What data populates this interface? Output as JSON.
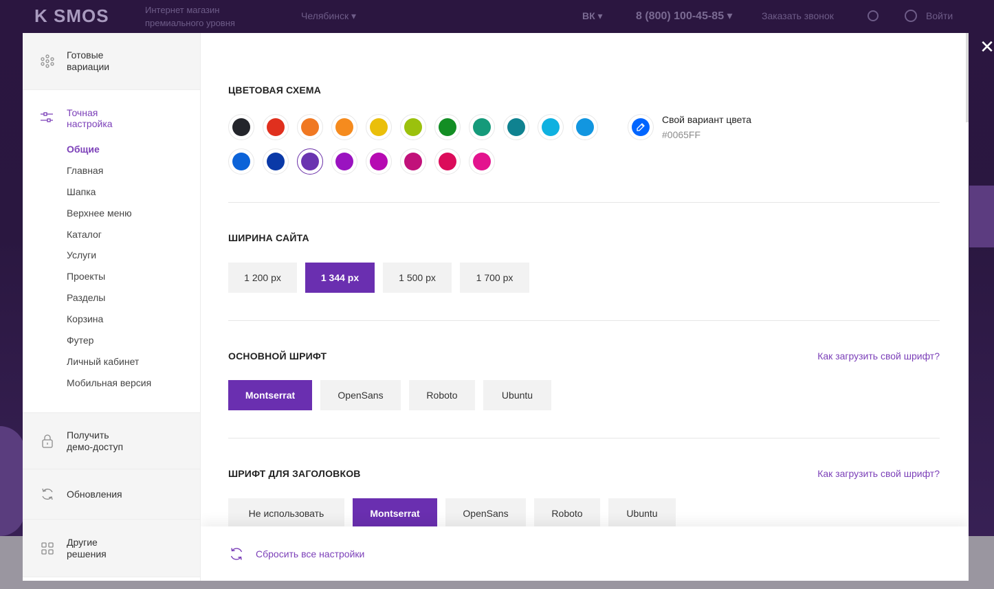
{
  "background": {
    "logo": "K   SMOS",
    "tagline": "Интернет магазин\nпремиального уровня",
    "city": "Челябинск ▾",
    "social": "ВК ▾",
    "phone": "8 (800) 100-45-85 ▾",
    "callback": "Заказать звонок",
    "login": "Войти"
  },
  "close_icon": "close-icon",
  "sidebar": {
    "variations": {
      "label": "Готовые\nвариации",
      "icon": "grid-dots-icon"
    },
    "tuning": {
      "label": "Точная\nнастройка",
      "icon": "sliders-icon"
    },
    "subnav": [
      {
        "label": "Общие",
        "active": true
      },
      {
        "label": "Главная"
      },
      {
        "label": "Шапка"
      },
      {
        "label": "Верхнее меню"
      },
      {
        "label": "Каталог"
      },
      {
        "label": "Услуги"
      },
      {
        "label": "Проекты"
      },
      {
        "label": "Разделы"
      },
      {
        "label": "Корзина"
      },
      {
        "label": "Футер"
      },
      {
        "label": "Личный кабинет"
      },
      {
        "label": "Мобильная версия"
      }
    ],
    "demo": {
      "label": "Получить\nдемо-доступ",
      "icon": "lock-icon"
    },
    "updates": {
      "label": "Обновления",
      "icon": "refresh-icon"
    },
    "others": {
      "label": "Другие\nрешения",
      "icon": "apps-icon"
    }
  },
  "color_scheme": {
    "title": "ЦВЕТОВАЯ СХЕМА",
    "swatches_row1": [
      "#23252b",
      "#e0301e",
      "#f07822",
      "#f58b1e",
      "#eabf0a",
      "#9bc10d",
      "#138e24",
      "#159a7a",
      "#0f8290",
      "#0fb1e0",
      "#1296e0"
    ],
    "swatches_row2": [
      "#0c63d8",
      "#0a39a7",
      "#6a34b0",
      "#9a13c0",
      "#b60ab2",
      "#c1117a",
      "#db0c5a",
      "#e3148e"
    ],
    "selected": "#6a34b0",
    "custom": {
      "title": "Свой вариант цвета",
      "value": "#0065FF",
      "color": "#0065FF"
    }
  },
  "site_width": {
    "title": "ШИРИНА САЙТА",
    "options": [
      {
        "label": "1 200 px"
      },
      {
        "label": "1 344 px",
        "active": true
      },
      {
        "label": "1 500 px"
      },
      {
        "label": "1 700 px"
      }
    ]
  },
  "main_font": {
    "title": "ОСНОВНОЙ ШРИФТ",
    "link": "Как загрузить свой шрифт?",
    "options": [
      {
        "label": "Montserrat",
        "active": true
      },
      {
        "label": "OpenSans"
      },
      {
        "label": "Roboto"
      },
      {
        "label": "Ubuntu"
      }
    ]
  },
  "heading_font": {
    "title": "ШРИФТ ДЛЯ ЗАГОЛОВКОВ",
    "link": "Как загрузить свой шрифт?",
    "options": [
      {
        "label": "Не использовать"
      },
      {
        "label": "Montserrat",
        "active": true
      },
      {
        "label": "OpenSans"
      },
      {
        "label": "Roboto"
      },
      {
        "label": "Ubuntu"
      }
    ]
  },
  "footer": {
    "reset_label": "Сбросить все настройки",
    "icon": "reset-icon"
  },
  "accent_color": "#6a2fb0"
}
